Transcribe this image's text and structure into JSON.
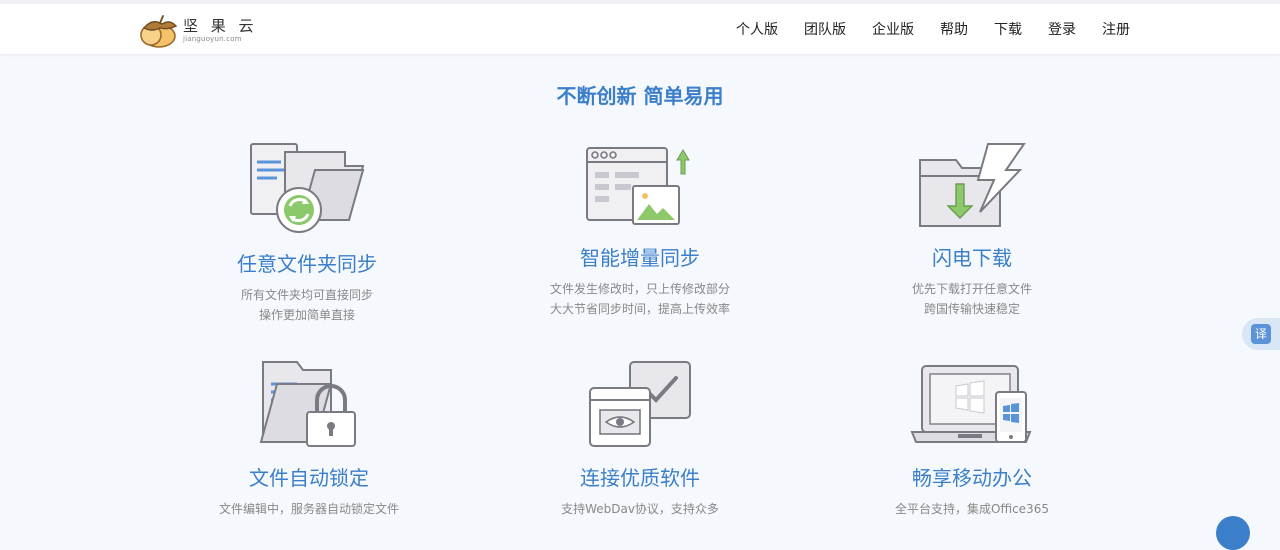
{
  "brand": {
    "name_cn": "坚 果 云",
    "domain": "jianguoyun.com"
  },
  "nav": [
    "个人版",
    "团队版",
    "企业版",
    "帮助",
    "下载",
    "登录",
    "注册"
  ],
  "headline": "不断创新 简单易用",
  "features": [
    {
      "title": "任意文件夹同步",
      "desc": [
        "所有文件夹均可直接同步",
        "操作更加简单直接"
      ]
    },
    {
      "title": "智能增量同步",
      "desc": [
        "文件发生修改时，只上传修改部分",
        "大大节省同步时间，提高上传效率"
      ]
    },
    {
      "title": "闪电下载",
      "desc": [
        "优先下载打开任意文件",
        "跨国传输快速稳定"
      ]
    },
    {
      "title": "文件自动锁定",
      "desc": [
        "文件编辑中，服务器自动锁定文件",
        ""
      ]
    },
    {
      "title": "连接优质软件",
      "desc": [
        "支持WebDav协议，支持众多",
        ""
      ]
    },
    {
      "title": "畅享移动办公",
      "desc": [
        "全平台支持，集成Office365",
        ""
      ]
    }
  ],
  "translate_label": "译",
  "colors": {
    "accent": "#3b7ec9",
    "green": "#7fc060",
    "icon_fill": "#e8e8ec",
    "icon_stroke": "#7a7a82"
  },
  "icons": [
    "acorn-logo-icon",
    "folder-sync-icon",
    "incremental-sync-icon",
    "lightning-download-icon",
    "folder-lock-icon",
    "software-connect-icon",
    "mobile-office-icon"
  ]
}
